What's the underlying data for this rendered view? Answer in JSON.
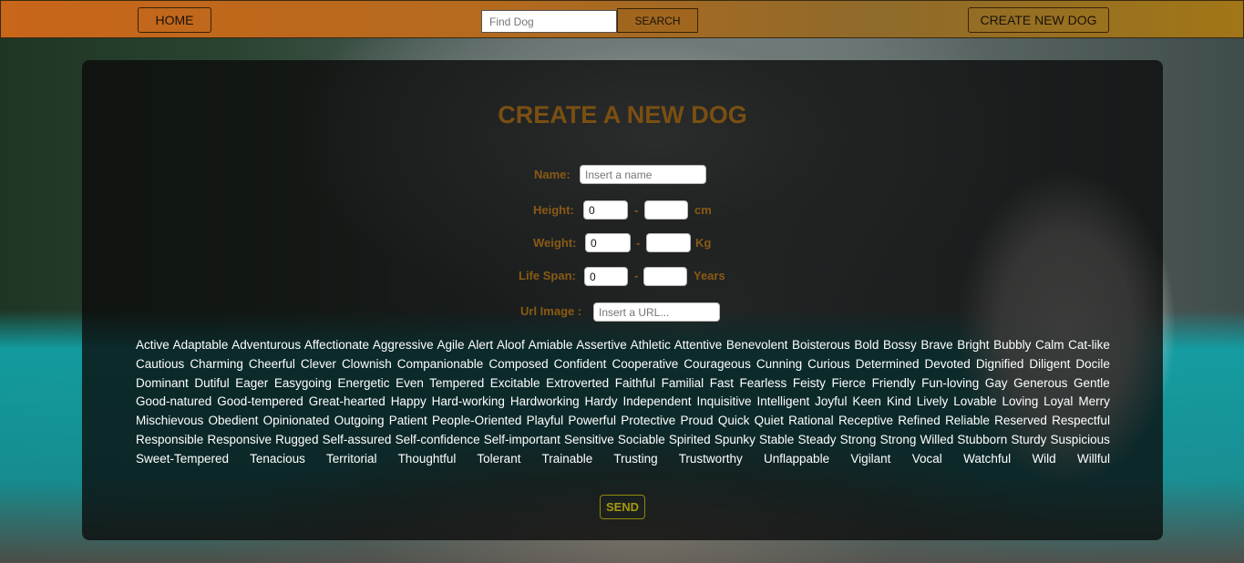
{
  "navbar": {
    "home_label": "HOME",
    "search_placeholder": "Find Dog",
    "search_label": "SEARCH",
    "create_label": "CREATE NEW DOG"
  },
  "form": {
    "title": "CREATE A NEW DOG",
    "name_label": "Name:",
    "name_placeholder": "Insert a name",
    "height_label": "Height:",
    "height_min": "0",
    "height_max": "",
    "height_unit": "cm",
    "weight_label": "Weight:",
    "weight_min": "0",
    "weight_max": "",
    "weight_unit": "Kg",
    "lifespan_label": "Life Span:",
    "lifespan_min": "0",
    "lifespan_max": "",
    "lifespan_unit": "Years",
    "dash": "-",
    "url_label": "Url Image :",
    "url_placeholder": "Insert a URL...",
    "send_label": "SEND"
  },
  "temperaments": [
    "Active",
    "Adaptable",
    "Adventurous",
    "Affectionate",
    "Aggressive",
    "Agile",
    "Alert",
    "Aloof",
    "Amiable",
    "Assertive",
    "Athletic",
    "Attentive",
    "Benevolent",
    "Boisterous",
    "Bold",
    "Bossy",
    "Brave",
    "Bright",
    "Bubbly",
    "Calm",
    "Cat-like",
    "Cautious",
    "Charming",
    "Cheerful",
    "Clever",
    "Clownish",
    "Companionable",
    "Composed",
    "Confident",
    "Cooperative",
    "Courageous",
    "Cunning",
    "Curious",
    "Determined",
    "Devoted",
    "Dignified",
    "Diligent",
    "Docile",
    "Dominant",
    "Dutiful",
    "Eager",
    "Easygoing",
    "Energetic",
    "Even Tempered",
    "Excitable",
    "Extroverted",
    "Faithful",
    "Familial",
    "Fast",
    "Fearless",
    "Feisty",
    "Fierce",
    "Friendly",
    "Fun-loving",
    "Gay",
    "Generous",
    "Gentle",
    "Good-natured",
    "Good-tempered",
    "Great-hearted",
    "Happy",
    "Hard-working",
    "Hardworking",
    "Hardy",
    "Independent",
    "Inquisitive",
    "Intelligent",
    "Joyful",
    "Keen",
    "Kind",
    "Lively",
    "Lovable",
    "Loving",
    "Loyal",
    "Merry",
    "Mischievous",
    "Obedient",
    "Opinionated",
    "Outgoing",
    "Patient",
    "People-Oriented",
    "Playful",
    "Powerful",
    "Protective",
    "Proud",
    "Quick",
    "Quiet",
    "Rational",
    "Receptive",
    "Refined",
    "Reliable",
    "Reserved",
    "Respectful",
    "Responsible",
    "Responsive",
    "Rugged",
    "Self-assured",
    "Self-confidence",
    "Self-important",
    "Sensitive",
    "Sociable",
    "Spirited",
    "Spunky",
    "Stable",
    "Steady",
    "Strong",
    "Strong Willed",
    "Stubborn",
    "Sturdy",
    "Suspicious",
    "Sweet-Tempered",
    "Tenacious",
    "Territorial",
    "Thoughtful",
    "Tolerant",
    "Trainable",
    "Trusting",
    "Trustworthy",
    "Unflappable",
    "Vigilant",
    "Vocal",
    "Watchful",
    "Wild",
    "Willful"
  ]
}
